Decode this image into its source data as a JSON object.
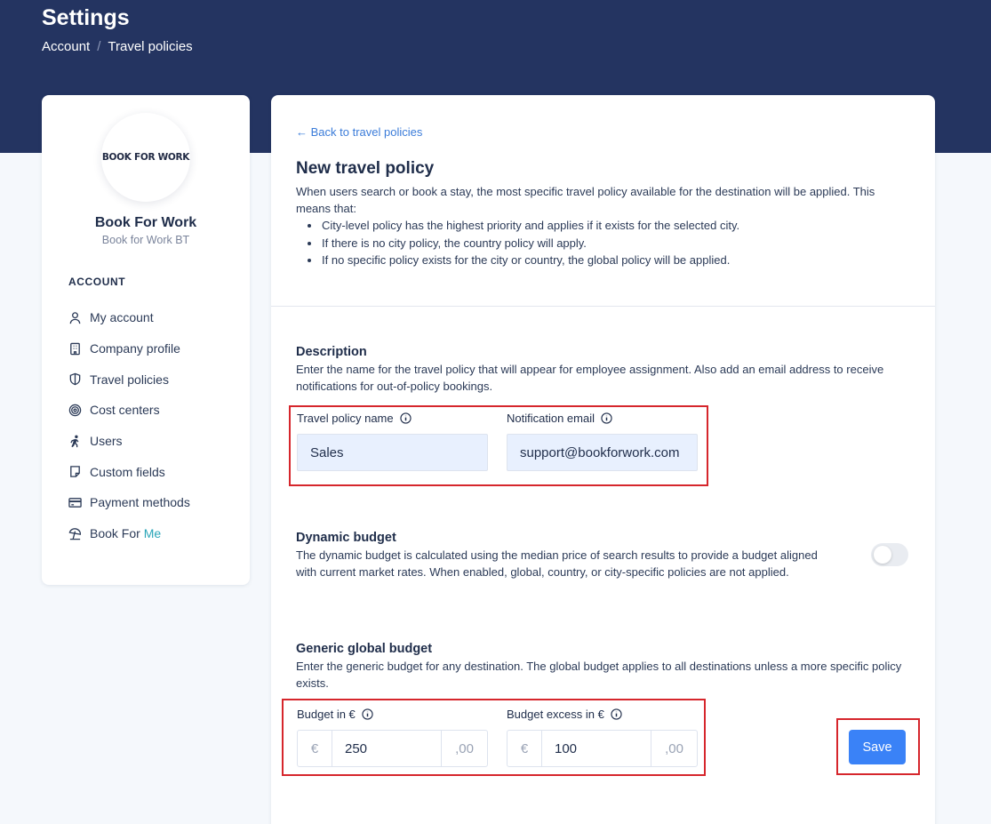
{
  "header": {
    "title": "Settings",
    "breadcrumb": [
      "Account",
      "Travel policies"
    ],
    "breadcrumb_separator": "/"
  },
  "sidebar": {
    "logo_text": "BOOK FOR WORK",
    "company_name": "Book For Work",
    "company_subtitle": "Book for Work BT",
    "section_label": "ACCOUNT",
    "items": [
      {
        "label": "My account",
        "icon": "user-icon"
      },
      {
        "label": "Company profile",
        "icon": "building-icon"
      },
      {
        "label": "Travel policies",
        "icon": "shield-icon"
      },
      {
        "label": "Cost centers",
        "icon": "target-icon"
      },
      {
        "label": "Users",
        "icon": "walking-user-icon"
      },
      {
        "label": "Custom fields",
        "icon": "note-icon"
      },
      {
        "label": "Payment methods",
        "icon": "credit-card-icon"
      },
      {
        "label": "Book For ",
        "label_accent": "Me",
        "icon": "beach-umbrella-icon"
      }
    ],
    "accent_color": "#2aa5b8"
  },
  "main": {
    "back_link": "← Back to travel policies",
    "title": "New travel policy",
    "intro_text": "When users search or book a stay, the most specific travel policy available for the destination will be applied. This means that:",
    "intro_bullets": [
      "City-level policy has the highest priority and applies if it exists for the selected city.",
      "If there is no city policy, the country policy will apply.",
      "If no specific policy exists for the city or country, the global policy will be applied."
    ],
    "description": {
      "title": "Description",
      "text": "Enter the name for the travel policy that will appear for employee assignment. Also add an email address to receive notifications for out-of-policy bookings.",
      "name_label": "Travel policy name",
      "name_value": "Sales",
      "email_label": "Notification email",
      "email_value": "support@bookforwork.com"
    },
    "dynamic_budget": {
      "title": "Dynamic budget",
      "text": "The dynamic budget is calculated using the median price of search results to provide a budget aligned with current market rates. When enabled, global, country, or city-specific policies are not applied.",
      "enabled": false
    },
    "global_budget": {
      "title": "Generic global budget",
      "text": "Enter the generic budget for any destination. The global budget applies to all destinations unless a more specific policy exists.",
      "budget_label": "Budget in €",
      "budget_value": "250",
      "excess_label": "Budget excess in €",
      "excess_value": "100",
      "currency_symbol": "€",
      "decimal_suffix": ",00"
    },
    "save_label": "Save"
  },
  "colors": {
    "header_bg": "#243461",
    "primary_button": "#3a82f7",
    "link": "#3b7cd9",
    "highlight_box": "#d6262c"
  }
}
